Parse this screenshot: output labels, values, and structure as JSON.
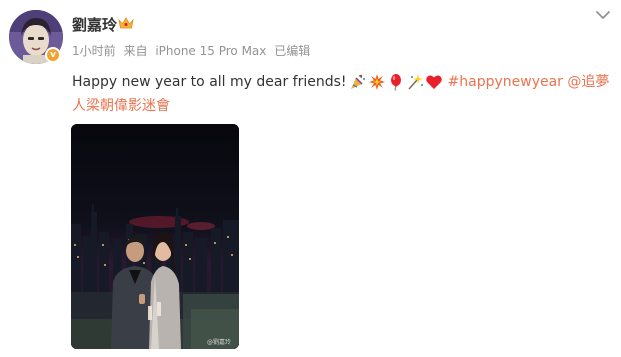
{
  "post": {
    "username": "劉嘉玲",
    "time": "1小时前",
    "source_prefix": "来自",
    "device": "iPhone 15 Pro Max",
    "edited": "已编辑",
    "text": "Happy new year to all my dear friends!",
    "emojis": [
      "party-popper",
      "collision",
      "balloon",
      "sparkler",
      "red-heart"
    ],
    "hashtag": "#happynewyear",
    "mention": "@追夢人梁朝偉影迷會",
    "photo_watermark": "@劉嘉玲"
  },
  "icons": {
    "verified": "verified-badge-icon",
    "crown": "crown-icon",
    "menu": "chevron-down-icon"
  },
  "colors": {
    "link_orange": "#eb7350",
    "meta_gray": "#939393",
    "badge_orange": "#f2a32b",
    "heart_red": "#e8202c"
  }
}
